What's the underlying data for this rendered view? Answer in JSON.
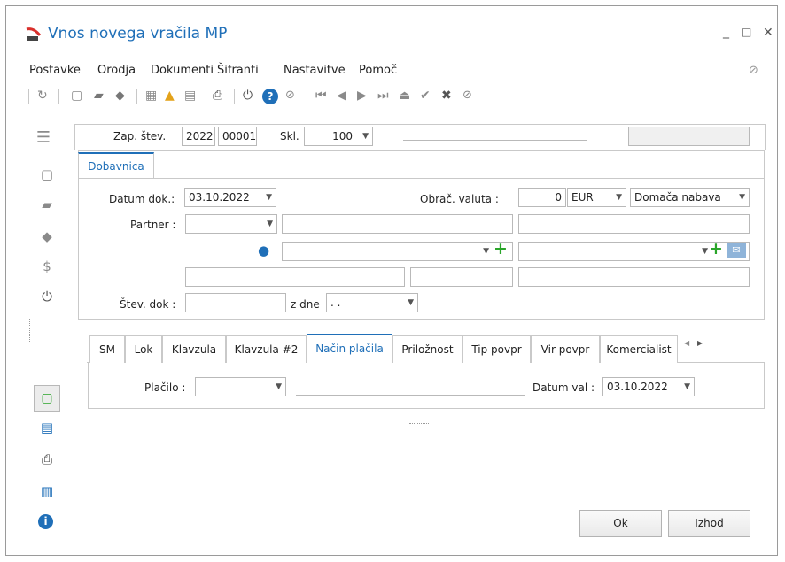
{
  "window": {
    "title": "Vnos novega vračila MP"
  },
  "menu": [
    "Postavke",
    "Orodja",
    "Dokumenti",
    "Šifranti",
    "Nastavitve",
    "Pomoč"
  ],
  "header": {
    "zap_label": "Zap. štev.",
    "zap_year": "2022",
    "zap_num": "00001",
    "skl_label": "Skl.",
    "skl_value": "100"
  },
  "tabs_top": [
    "Dobavnica"
  ],
  "form": {
    "datum_label": "Datum dok.:",
    "datum_value": "03.10.2022",
    "valuta_label": "Obrač. valuta :",
    "valuta_amount": "0",
    "valuta_currency": "EUR",
    "nabava": "Domača nabava",
    "partner_label": "Partner :",
    "stev_label": "Štev. dok :",
    "zdne_label": "z dne",
    "zdne_value": ". ."
  },
  "tabs_bottom": [
    "SM",
    "Lok",
    "Klavzula",
    "Klavzula #2",
    "Način plačila",
    "Priložnost",
    "Tip povpr",
    "Vir povpr",
    "Komercialist"
  ],
  "payment": {
    "placilo_label": "Plačilo :",
    "datum_val_label": "Datum val :",
    "datum_val_value": "03.10.2022"
  },
  "buttons": {
    "ok": "Ok",
    "exit": "Izhod"
  },
  "colors": {
    "accent": "#1f6fb8",
    "green": "#2aa52a",
    "active_tab": "#1f6fb8"
  }
}
